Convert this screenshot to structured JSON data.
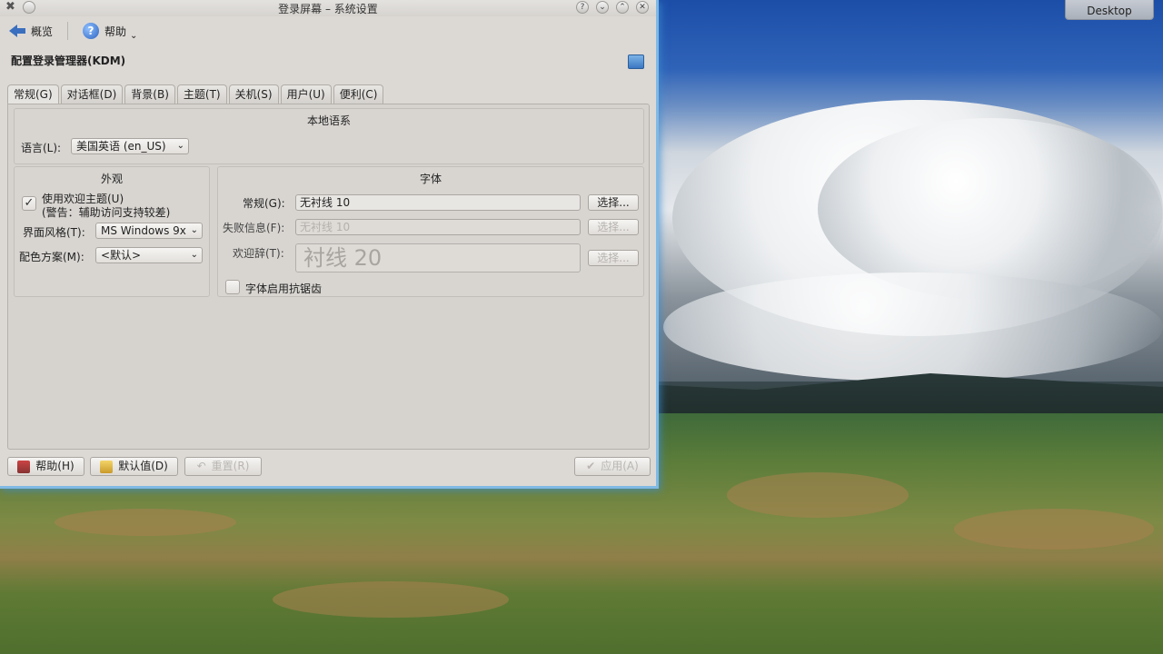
{
  "window": {
    "title": "登录屏幕 – 系统设置",
    "title_buttons": [
      "?",
      "⌄",
      "⌃",
      "✕"
    ]
  },
  "toolbar": {
    "overview_label": "概览",
    "help_label": "帮助"
  },
  "heading": "配置登录管理器(KDM)",
  "tabs": [
    {
      "label": "常规(G)",
      "active": true
    },
    {
      "label": "对话框(D)",
      "active": false
    },
    {
      "label": "背景(B)",
      "active": false
    },
    {
      "label": "主题(T)",
      "active": false
    },
    {
      "label": "关机(S)",
      "active": false
    },
    {
      "label": "用户(U)",
      "active": false
    },
    {
      "label": "便利(C)",
      "active": false
    }
  ],
  "locale": {
    "title": "本地语系",
    "language_label": "语言(L):",
    "language_value": "美国英语 (en_US)"
  },
  "appearance": {
    "title": "外观",
    "welcome_theme_label": "使用欢迎主题(U)",
    "welcome_theme_note": "(警告：辅助访问支持较差)",
    "welcome_theme_checked": true,
    "style_label": "界面风格(T):",
    "style_value": "MS Windows 9x",
    "color_label": "配色方案(M):",
    "color_value": "<默认>"
  },
  "fonts": {
    "title": "字体",
    "general_label": "常规(G):",
    "general_value": "无衬线 10",
    "fail_label": "失败信息(F):",
    "fail_value": "无衬线 10",
    "greeting_label": "欢迎辞(T):",
    "greeting_value": "衬线 20",
    "choose_label": "选择...",
    "antialias_label": "字体启用抗锯齿",
    "antialias_checked": false
  },
  "buttons": {
    "help": "帮助(H)",
    "defaults": "默认值(D)",
    "reset": "重置(R)",
    "apply": "应用(A)"
  },
  "desktop": {
    "label": "Desktop"
  }
}
